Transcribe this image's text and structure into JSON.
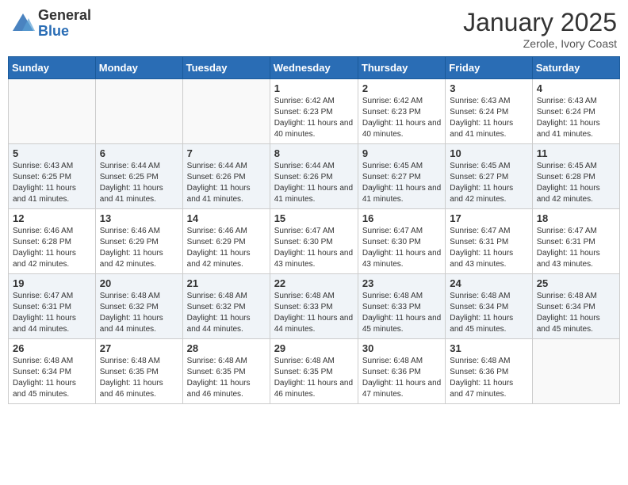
{
  "header": {
    "logo_general": "General",
    "logo_blue": "Blue",
    "month_title": "January 2025",
    "location": "Zerole, Ivory Coast"
  },
  "weekdays": [
    "Sunday",
    "Monday",
    "Tuesday",
    "Wednesday",
    "Thursday",
    "Friday",
    "Saturday"
  ],
  "weeks": [
    [
      {
        "day": "",
        "info": ""
      },
      {
        "day": "",
        "info": ""
      },
      {
        "day": "",
        "info": ""
      },
      {
        "day": "1",
        "info": "Sunrise: 6:42 AM\nSunset: 6:23 PM\nDaylight: 11 hours and 40 minutes."
      },
      {
        "day": "2",
        "info": "Sunrise: 6:42 AM\nSunset: 6:23 PM\nDaylight: 11 hours and 40 minutes."
      },
      {
        "day": "3",
        "info": "Sunrise: 6:43 AM\nSunset: 6:24 PM\nDaylight: 11 hours and 41 minutes."
      },
      {
        "day": "4",
        "info": "Sunrise: 6:43 AM\nSunset: 6:24 PM\nDaylight: 11 hours and 41 minutes."
      }
    ],
    [
      {
        "day": "5",
        "info": "Sunrise: 6:43 AM\nSunset: 6:25 PM\nDaylight: 11 hours and 41 minutes."
      },
      {
        "day": "6",
        "info": "Sunrise: 6:44 AM\nSunset: 6:25 PM\nDaylight: 11 hours and 41 minutes."
      },
      {
        "day": "7",
        "info": "Sunrise: 6:44 AM\nSunset: 6:26 PM\nDaylight: 11 hours and 41 minutes."
      },
      {
        "day": "8",
        "info": "Sunrise: 6:44 AM\nSunset: 6:26 PM\nDaylight: 11 hours and 41 minutes."
      },
      {
        "day": "9",
        "info": "Sunrise: 6:45 AM\nSunset: 6:27 PM\nDaylight: 11 hours and 41 minutes."
      },
      {
        "day": "10",
        "info": "Sunrise: 6:45 AM\nSunset: 6:27 PM\nDaylight: 11 hours and 42 minutes."
      },
      {
        "day": "11",
        "info": "Sunrise: 6:45 AM\nSunset: 6:28 PM\nDaylight: 11 hours and 42 minutes."
      }
    ],
    [
      {
        "day": "12",
        "info": "Sunrise: 6:46 AM\nSunset: 6:28 PM\nDaylight: 11 hours and 42 minutes."
      },
      {
        "day": "13",
        "info": "Sunrise: 6:46 AM\nSunset: 6:29 PM\nDaylight: 11 hours and 42 minutes."
      },
      {
        "day": "14",
        "info": "Sunrise: 6:46 AM\nSunset: 6:29 PM\nDaylight: 11 hours and 42 minutes."
      },
      {
        "day": "15",
        "info": "Sunrise: 6:47 AM\nSunset: 6:30 PM\nDaylight: 11 hours and 43 minutes."
      },
      {
        "day": "16",
        "info": "Sunrise: 6:47 AM\nSunset: 6:30 PM\nDaylight: 11 hours and 43 minutes."
      },
      {
        "day": "17",
        "info": "Sunrise: 6:47 AM\nSunset: 6:31 PM\nDaylight: 11 hours and 43 minutes."
      },
      {
        "day": "18",
        "info": "Sunrise: 6:47 AM\nSunset: 6:31 PM\nDaylight: 11 hours and 43 minutes."
      }
    ],
    [
      {
        "day": "19",
        "info": "Sunrise: 6:47 AM\nSunset: 6:31 PM\nDaylight: 11 hours and 44 minutes."
      },
      {
        "day": "20",
        "info": "Sunrise: 6:48 AM\nSunset: 6:32 PM\nDaylight: 11 hours and 44 minutes."
      },
      {
        "day": "21",
        "info": "Sunrise: 6:48 AM\nSunset: 6:32 PM\nDaylight: 11 hours and 44 minutes."
      },
      {
        "day": "22",
        "info": "Sunrise: 6:48 AM\nSunset: 6:33 PM\nDaylight: 11 hours and 44 minutes."
      },
      {
        "day": "23",
        "info": "Sunrise: 6:48 AM\nSunset: 6:33 PM\nDaylight: 11 hours and 45 minutes."
      },
      {
        "day": "24",
        "info": "Sunrise: 6:48 AM\nSunset: 6:34 PM\nDaylight: 11 hours and 45 minutes."
      },
      {
        "day": "25",
        "info": "Sunrise: 6:48 AM\nSunset: 6:34 PM\nDaylight: 11 hours and 45 minutes."
      }
    ],
    [
      {
        "day": "26",
        "info": "Sunrise: 6:48 AM\nSunset: 6:34 PM\nDaylight: 11 hours and 45 minutes."
      },
      {
        "day": "27",
        "info": "Sunrise: 6:48 AM\nSunset: 6:35 PM\nDaylight: 11 hours and 46 minutes."
      },
      {
        "day": "28",
        "info": "Sunrise: 6:48 AM\nSunset: 6:35 PM\nDaylight: 11 hours and 46 minutes."
      },
      {
        "day": "29",
        "info": "Sunrise: 6:48 AM\nSunset: 6:35 PM\nDaylight: 11 hours and 46 minutes."
      },
      {
        "day": "30",
        "info": "Sunrise: 6:48 AM\nSunset: 6:36 PM\nDaylight: 11 hours and 47 minutes."
      },
      {
        "day": "31",
        "info": "Sunrise: 6:48 AM\nSunset: 6:36 PM\nDaylight: 11 hours and 47 minutes."
      },
      {
        "day": "",
        "info": ""
      }
    ]
  ]
}
